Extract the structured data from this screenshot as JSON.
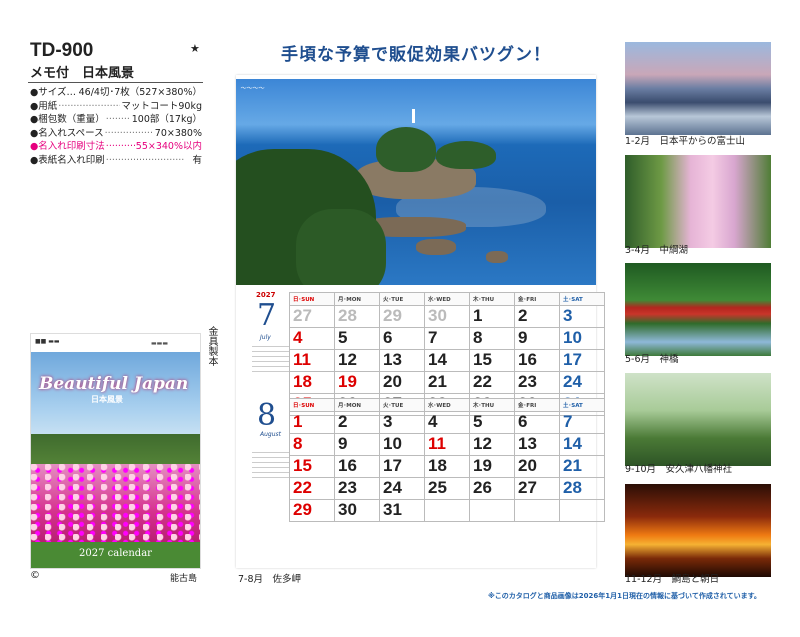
{
  "product": {
    "code": "TD-900",
    "star": "★",
    "name": "メモ付　日本風景"
  },
  "specs": [
    {
      "label": "●サイズ…",
      "value": "46/4切･7枚（527×380%）",
      "pink": false
    },
    {
      "label": "●用紙",
      "value": "マットコート90kg",
      "pink": false
    },
    {
      "label": "●梱包数（重量）",
      "value": "100部（17kg）",
      "pink": false
    },
    {
      "label": "●名入れスペース",
      "value": "70×380%",
      "pink": false
    },
    {
      "label": "●名入れ印刷寸法",
      "value": "55×340%以内",
      "pink": true
    },
    {
      "label": "●表紙名入れ印刷",
      "value": "有",
      "pink": false
    }
  ],
  "binding": "金具製本",
  "cover": {
    "title": "Beautiful Japan",
    "subtitle": "日本風景",
    "calendar_label": "2027 calendar",
    "caption": "能古島"
  },
  "copyright": "©",
  "headline": "手頃な予算で販促効果バツグン！",
  "main_photo_label": "7-8月　佐多岬",
  "weekday_headers": [
    "日･SUN",
    "月･MON",
    "火･TUE",
    "水･WED",
    "木･THU",
    "金･FRI",
    "土･SAT"
  ],
  "months": [
    {
      "number": "7",
      "year": "2027",
      "english": "July",
      "weeks": [
        [
          "27",
          "28",
          "29",
          "30",
          "1",
          "2",
          "3"
        ],
        [
          "4",
          "5",
          "6",
          "7",
          "8",
          "9",
          "10"
        ],
        [
          "11",
          "12",
          "13",
          "14",
          "15",
          "16",
          "17"
        ],
        [
          "18",
          "19",
          "20",
          "21",
          "22",
          "23",
          "24"
        ],
        [
          "25",
          "26",
          "27",
          "28",
          "29",
          "30",
          "31"
        ]
      ],
      "grey_first_row": 4,
      "holidays": [
        "19"
      ]
    },
    {
      "number": "8",
      "year": "",
      "english": "August",
      "weeks": [
        [
          "1",
          "2",
          "3",
          "4",
          "5",
          "6",
          "7"
        ],
        [
          "8",
          "9",
          "10",
          "11",
          "12",
          "13",
          "14"
        ],
        [
          "15",
          "16",
          "17",
          "18",
          "19",
          "20",
          "21"
        ],
        [
          "22",
          "23",
          "24",
          "25",
          "26",
          "27",
          "28"
        ],
        [
          "29",
          "30",
          "31",
          "",
          "",
          "",
          ""
        ]
      ],
      "grey_first_row": 0,
      "holidays": [
        "11"
      ]
    }
  ],
  "thumbnails": [
    {
      "caption": "1-2月　日本平からの富士山",
      "icon": "mount-fuji-photo"
    },
    {
      "caption": "3-4月　中綱湖",
      "icon": "cherry-lake-photo"
    },
    {
      "caption": "5-6月　神橋",
      "icon": "red-bridge-photo"
    },
    {
      "caption": "9-10月　安久津八幡神社",
      "icon": "pagoda-photo"
    },
    {
      "caption": "11-12月　鯛島と朝日",
      "icon": "sunrise-photo"
    }
  ],
  "notice": "※このカタログと商品画像は2026年1月1日現在の情報に基づいて作成されています。",
  "colors": {
    "navy": "#1f4e8f",
    "red": "#d00000",
    "pink": "#e6007e",
    "blue": "#1f5fa8"
  }
}
